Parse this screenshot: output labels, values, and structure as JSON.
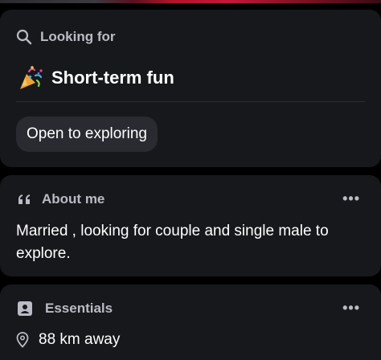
{
  "looking_for": {
    "heading": "Looking for",
    "title": "Short-term fun",
    "emoji": "🎉",
    "chip": "Open to exploring"
  },
  "about": {
    "heading": "About me",
    "text": "Married , looking for couple and single male to explore.",
    "more": "•••"
  },
  "essentials": {
    "heading": "Essentials",
    "distance": "88 km away",
    "more": "•••"
  },
  "icons": {
    "looking": "search-icon",
    "about": "quote-icon",
    "essentials": "profile-card-icon",
    "distance": "location-pin-icon"
  },
  "colors": {
    "background": "#000000",
    "card": "#17181c",
    "chip": "#2a2b31",
    "muted_text": "#b9bcc4",
    "text": "#ffffff"
  }
}
